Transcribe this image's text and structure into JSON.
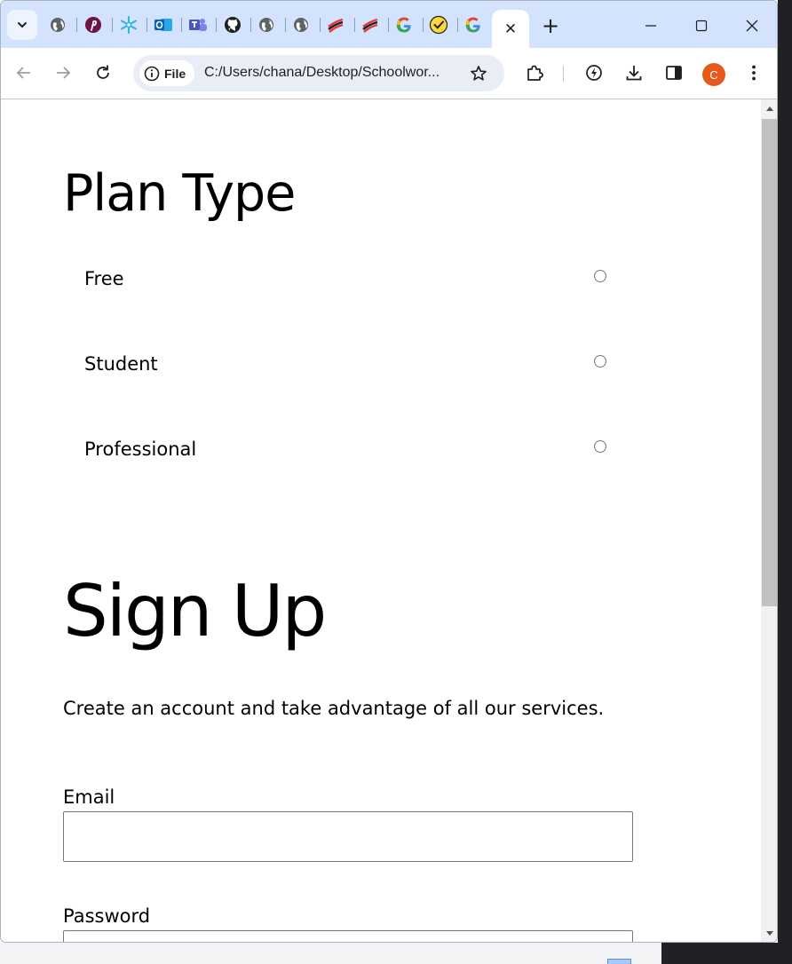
{
  "browser": {
    "tabs": [
      {
        "icon": "tab-search-chevron-icon"
      },
      {
        "icon": "globe-icon"
      },
      {
        "icon": "pinterest-icon"
      },
      {
        "icon": "snowflake-icon"
      },
      {
        "icon": "outlook-icon"
      },
      {
        "icon": "teams-icon"
      },
      {
        "icon": "github-icon"
      },
      {
        "icon": "globe-icon"
      },
      {
        "icon": "globe-icon"
      },
      {
        "icon": "stack-logo-icon"
      },
      {
        "icon": "stack-logo-icon"
      },
      {
        "icon": "google-icon"
      },
      {
        "icon": "checkmark-circle-icon"
      },
      {
        "icon": "google-icon"
      }
    ],
    "active_tab_close": "✕",
    "new_tab": "+",
    "omnibox": {
      "chip_label": "File",
      "url": "C:/Users/chana/Desktop/Schoolwor..."
    },
    "profile_initial": "C",
    "colors": {
      "tabstrip": "#d3e3fd",
      "avatar": "#e8581c",
      "omnibox": "#e9eef6"
    }
  },
  "page": {
    "plan_title": "Plan Type",
    "plans": [
      {
        "label": "Free",
        "checked": false
      },
      {
        "label": "Student",
        "checked": false
      },
      {
        "label": "Professional",
        "checked": false
      }
    ],
    "signup_title": "Sign Up",
    "signup_description": "Create an account and take advantage of all our services.",
    "fields": {
      "email_label": "Email",
      "email_value": "",
      "password_label": "Password",
      "password_value": ""
    }
  }
}
